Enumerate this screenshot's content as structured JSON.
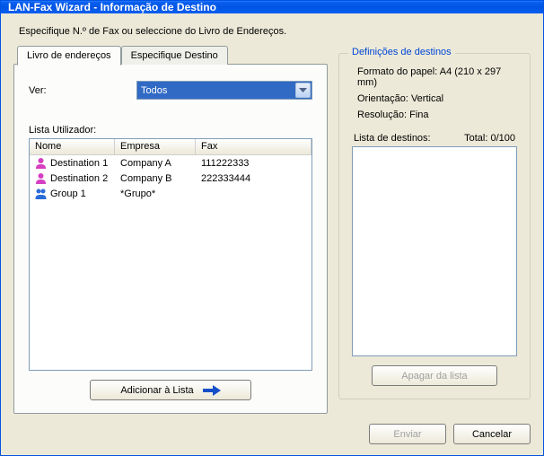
{
  "title": "LAN-Fax Wizard - Informação de Destino",
  "instruction": "Especifique N.º de Fax ou seleccione do Livro de Endereços.",
  "tabs": [
    {
      "label": "Livro de endereços",
      "active": true
    },
    {
      "label": "Especifique Destino",
      "active": false
    }
  ],
  "view": {
    "label": "Ver:",
    "selected": "Todos"
  },
  "userlist": {
    "label": "Lista Utilizador:",
    "columns": {
      "name": "Nome",
      "company": "Empresa",
      "fax": "Fax"
    },
    "rows": [
      {
        "name": "Destination 1",
        "company": "Company A",
        "fax": "111222333",
        "type": "person"
      },
      {
        "name": "Destination 2",
        "company": "Company B",
        "fax": "222333444",
        "type": "person"
      },
      {
        "name": "Group 1",
        "company": "*Grupo*",
        "fax": "",
        "type": "group"
      }
    ]
  },
  "buttons": {
    "add": "Adicionar à Lista",
    "delete": "Apagar da lista",
    "send": "Enviar",
    "cancel": "Cancelar"
  },
  "destinations": {
    "groupTitle": "Definições de destinos",
    "paperLabel": "Formato do papel:",
    "paperValue": "A4 (210 x 297 mm)",
    "orientationLabel": "Orientação:",
    "orientationValue": "Vertical",
    "resolutionLabel": "Resolução:",
    "resolutionValue": "Fina",
    "listLabel": "Lista de destinos:",
    "totalLabel": "Total: 0/100"
  }
}
